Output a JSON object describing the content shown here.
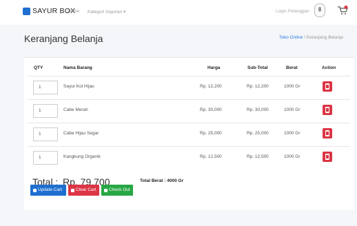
{
  "nav": {
    "brand": "SAYUR BOX",
    "home": "Home",
    "kategori": "Kategori Sayuran ▾",
    "login": "Login Pelanggan"
  },
  "page": {
    "title": "Keranjang Belanja",
    "breadcrumb_home": "Toko Online",
    "breadcrumb_sep": "/",
    "breadcrumb_current": "Keranjang Belanja"
  },
  "table": {
    "headers": {
      "qty": "QTY",
      "nama": "Nama Barang",
      "harga": "Harga",
      "subtotal": "Sub-Total",
      "berat": "Berat",
      "action": "Action"
    },
    "rows": [
      {
        "qty": "1",
        "nama": "Sayur Kol Hijau",
        "harga": "Rp. 12,200",
        "subtotal": "Rp. 12,200",
        "berat": "1000 Gr"
      },
      {
        "qty": "1",
        "nama": "Cabe Merah",
        "harga": "Rp. 30,000",
        "subtotal": "Rp. 30,000",
        "berat": "1000 Gr"
      },
      {
        "qty": "1",
        "nama": "Cabe Hijau Segar",
        "harga": "Rp. 25,000",
        "subtotal": "Rp. 25,000",
        "berat": "1000 Gr"
      },
      {
        "qty": "1",
        "nama": "Kangkung Organik",
        "harga": "Rp. 12,500",
        "subtotal": "Rp. 12,500",
        "berat": "1000 Gr"
      }
    ]
  },
  "summary": {
    "total_label": "Total :",
    "total_value": "Rp. 79,700",
    "total_weight": "Total Berat : 4000 Gr"
  },
  "buttons": {
    "update": "Update Cart",
    "clear": "Clear Cart",
    "checkout": "Check Out"
  },
  "colors": {
    "primary": "#1f6fd0",
    "danger": "#dc3545",
    "success": "#28a745"
  }
}
